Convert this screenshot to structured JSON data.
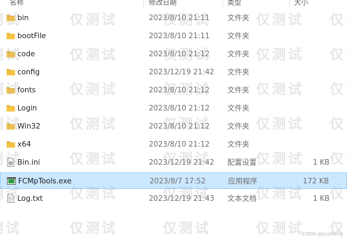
{
  "columns": {
    "name": "名称",
    "date": "修改日期",
    "type": "类型",
    "size": "大小"
  },
  "colors": {
    "folder": "#f5c342",
    "folder_dark": "#e0a928",
    "selected_bg": "#cce8ff",
    "selected_border": "#99d1ff",
    "exe_icon": "#2f9e44"
  },
  "files": [
    {
      "name": "bin",
      "date": "2023/8/10 21:11",
      "type": "文件夹",
      "size": "",
      "icon": "folder-icon"
    },
    {
      "name": "bootFile",
      "date": "2023/8/10 21:11",
      "type": "文件夹",
      "size": "",
      "icon": "folder-icon"
    },
    {
      "name": "code",
      "date": "2023/8/10 21:12",
      "type": "文件夹",
      "size": "",
      "icon": "folder-icon"
    },
    {
      "name": "config",
      "date": "2023/12/19 21:42",
      "type": "文件夹",
      "size": "",
      "icon": "folder-icon"
    },
    {
      "name": "fonts",
      "date": "2023/8/10 21:12",
      "type": "文件夹",
      "size": "",
      "icon": "folder-icon"
    },
    {
      "name": "Login",
      "date": "2023/8/10 21:12",
      "type": "文件夹",
      "size": "",
      "icon": "folder-icon"
    },
    {
      "name": "Win32",
      "date": "2023/8/10 21:12",
      "type": "文件夹",
      "size": "",
      "icon": "folder-icon"
    },
    {
      "name": "x64",
      "date": "2023/8/10 21:12",
      "type": "文件夹",
      "size": "",
      "icon": "folder-icon"
    },
    {
      "name": "Bin.ini",
      "date": "2023/12/19 21:42",
      "type": "配置设置",
      "size": "1 KB",
      "icon": "settings-file-icon"
    },
    {
      "name": "FCMpTools.exe",
      "date": "2023/8/7 17:52",
      "type": "应用程序",
      "size": "172 KB",
      "icon": "application-icon",
      "selected": true
    },
    {
      "name": "Log.txt",
      "date": "2023/12/19 21:43",
      "type": "文本文档",
      "size": "1 KB",
      "icon": "text-file-icon"
    }
  ],
  "watermark_text": "仅测试",
  "credit": "CSDN @jiusheng"
}
